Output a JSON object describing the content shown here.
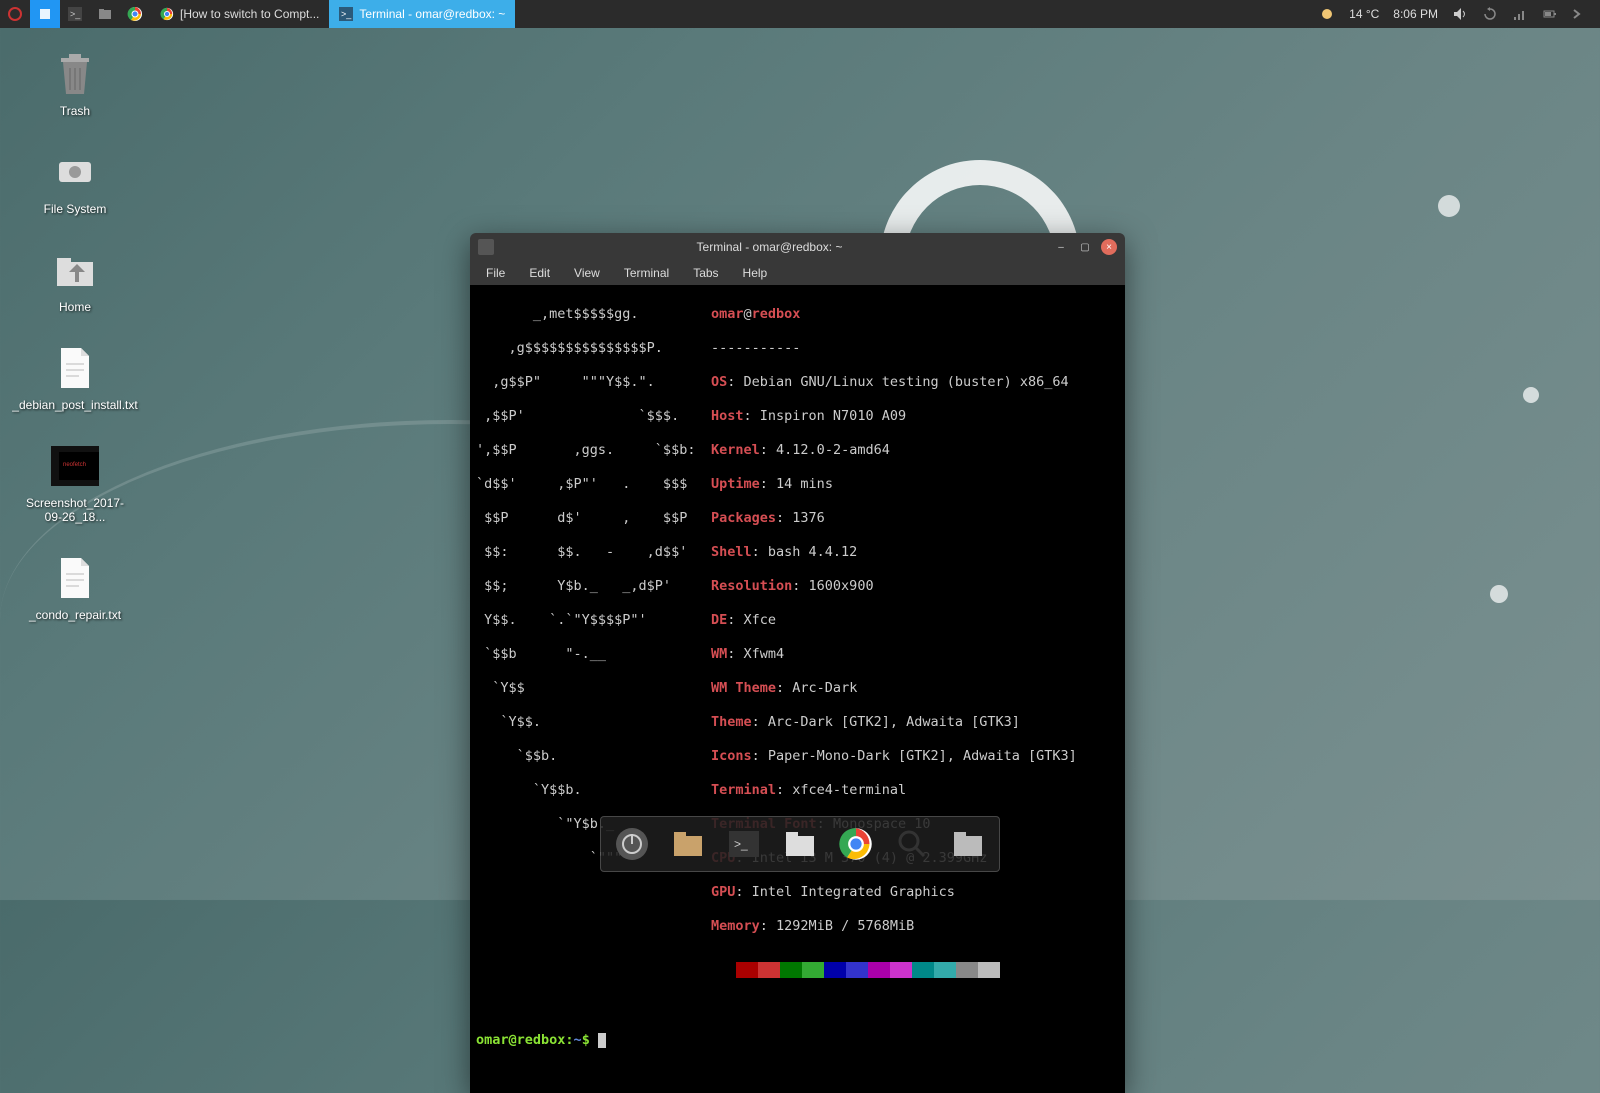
{
  "panel": {
    "tasks": [
      {
        "label": "[How to switch to Compt...",
        "active": false
      },
      {
        "label": "Terminal - omar@redbox: ~",
        "active": true
      }
    ],
    "weather": "14 °C",
    "clock": "8:06 PM"
  },
  "desktop": {
    "icons": [
      {
        "name": "trash",
        "label": "Trash"
      },
      {
        "name": "filesystem",
        "label": "File System"
      },
      {
        "name": "home",
        "label": "Home"
      },
      {
        "name": "textfile1",
        "label": "_debian_post_install.txt"
      },
      {
        "name": "screenshot",
        "label": "Screenshot_2017-09-26_18..."
      },
      {
        "name": "textfile2",
        "label": "_condo_repair.txt"
      }
    ]
  },
  "terminal": {
    "title": "Terminal - omar@redbox: ~",
    "menus": [
      "File",
      "Edit",
      "View",
      "Terminal",
      "Tabs",
      "Help"
    ],
    "user": "omar",
    "at": "@",
    "host": "redbox",
    "dashes": "-----------",
    "ascii": [
      "       _,met$$$$$gg.",
      "    ,g$$$$$$$$$$$$$$$P.",
      "  ,g$$P\"     \"\"\"Y$$.\".",
      " ,$$P'              `$$$.",
      "',$$P       ,ggs.     `$$b:",
      "`d$$'     ,$P\"'   .    $$$",
      " $$P      d$'     ,    $$P",
      " $$:      $$.   -    ,d$$'",
      " $$;      Y$b._   _,d$P'",
      " Y$$.    `.`\"Y$$$$P\"'",
      " `$$b      \"-.__",
      "  `Y$$",
      "   `Y$$.",
      "     `$$b.",
      "       `Y$$b.",
      "          `\"Y$b._",
      "              `\"\"\""
    ],
    "info": [
      {
        "label": "OS",
        "value": "Debian GNU/Linux testing (buster) x86_64"
      },
      {
        "label": "Host",
        "value": "Inspiron N7010 A09"
      },
      {
        "label": "Kernel",
        "value": "4.12.0-2-amd64"
      },
      {
        "label": "Uptime",
        "value": "14 mins"
      },
      {
        "label": "Packages",
        "value": "1376"
      },
      {
        "label": "Shell",
        "value": "bash 4.4.12"
      },
      {
        "label": "Resolution",
        "value": "1600x900"
      },
      {
        "label": "DE",
        "value": "Xfce"
      },
      {
        "label": "WM",
        "value": "Xfwm4"
      },
      {
        "label": "WM Theme",
        "value": "Arc-Dark"
      },
      {
        "label": "Theme",
        "value": "Arc-Dark [GTK2], Adwaita [GTK3]"
      },
      {
        "label": "Icons",
        "value": "Paper-Mono-Dark [GTK2], Adwaita [GTK3]"
      },
      {
        "label": "Terminal",
        "value": "xfce4-terminal"
      },
      {
        "label": "Terminal Font",
        "value": "Monospace 10"
      },
      {
        "label": "CPU",
        "value": "Intel i3 M 370 (4) @ 2.399GHz"
      },
      {
        "label": "GPU",
        "value": "Intel Integrated Graphics"
      },
      {
        "label": "Memory",
        "value": "1292MiB / 5768MiB"
      }
    ],
    "swatches": [
      "#a00",
      "#c33",
      "#070",
      "#3a3",
      "#00a",
      "#33c",
      "#a0a",
      "#c3c",
      "#088",
      "#3aa",
      "#888",
      "#bbb"
    ],
    "prompt_user_host": "omar@redbox",
    "prompt_path": ":~",
    "prompt_symbol": "$ "
  },
  "dock": {
    "items": [
      "power",
      "files",
      "terminal",
      "files2",
      "chrome",
      "search",
      "files3"
    ]
  }
}
